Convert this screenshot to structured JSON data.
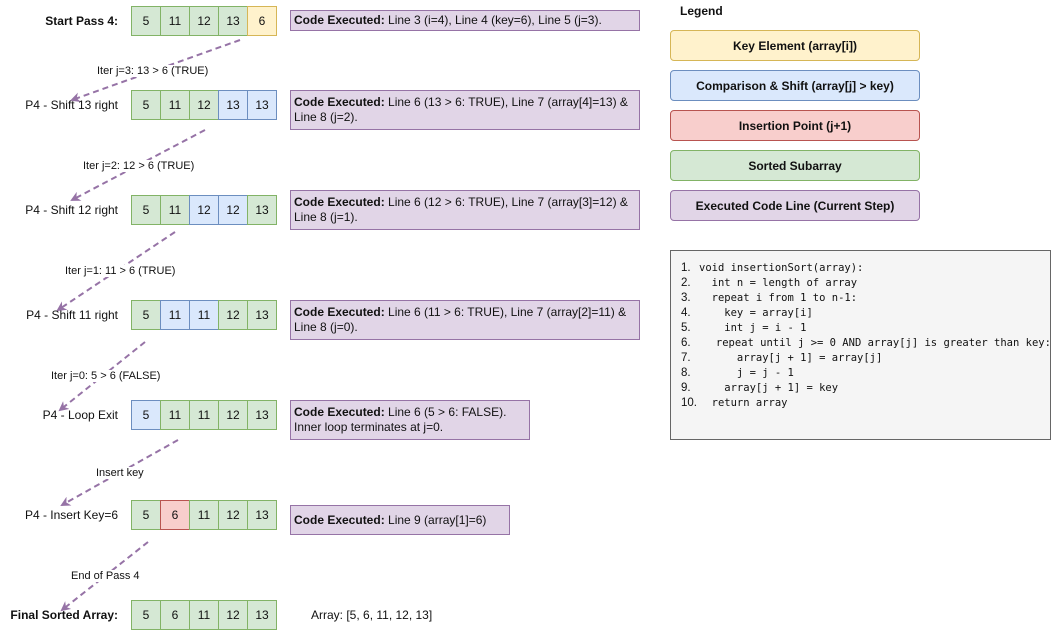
{
  "colors": {
    "sorted": "#d5e8d4",
    "key": "#fff2cc",
    "shift": "#dae8fc",
    "insert": "#f8cecc",
    "code": "#e1d5e7",
    "arrow": "#9673a6"
  },
  "rows": [
    {
      "label": "Start Pass 4:",
      "bold": true,
      "cells": [
        {
          "v": "5",
          "t": "sorted"
        },
        {
          "v": "11",
          "t": "sorted"
        },
        {
          "v": "12",
          "t": "sorted"
        },
        {
          "v": "13",
          "t": "sorted"
        },
        {
          "v": "6",
          "t": "key"
        }
      ],
      "code_prefix": "Code Executed:",
      "code_text": "Line 3 (i=4), Line 4 (key=6), Line 5 (j=3)."
    },
    {
      "label": "P4 - Shift 13 right",
      "bold": false,
      "cells": [
        {
          "v": "5",
          "t": "sorted"
        },
        {
          "v": "11",
          "t": "sorted"
        },
        {
          "v": "12",
          "t": "sorted"
        },
        {
          "v": "13",
          "t": "shift"
        },
        {
          "v": "13",
          "t": "shift"
        }
      ],
      "code_prefix": "Code Executed:",
      "code_text": "Line 6 (13 > 6: TRUE), Line 7 (array[4]=13) & Line 8 (j=2)."
    },
    {
      "label": "P4 - Shift 12 right",
      "bold": false,
      "cells": [
        {
          "v": "5",
          "t": "sorted"
        },
        {
          "v": "11",
          "t": "sorted"
        },
        {
          "v": "12",
          "t": "shift"
        },
        {
          "v": "12",
          "t": "shift"
        },
        {
          "v": "13",
          "t": "sorted"
        }
      ],
      "code_prefix": "Code Executed:",
      "code_text": "Line 6 (12 > 6: TRUE), Line 7 (array[3]=12) & Line 8 (j=1)."
    },
    {
      "label": "P4 - Shift 11 right",
      "bold": false,
      "cells": [
        {
          "v": "5",
          "t": "sorted"
        },
        {
          "v": "11",
          "t": "shift"
        },
        {
          "v": "11",
          "t": "shift"
        },
        {
          "v": "12",
          "t": "sorted"
        },
        {
          "v": "13",
          "t": "sorted"
        }
      ],
      "code_prefix": "Code Executed:",
      "code_text": "Line 6 (11 > 6: TRUE), Line 7 (array[2]=11) & Line 8 (j=0)."
    },
    {
      "label": "P4 - Loop Exit",
      "bold": false,
      "cells": [
        {
          "v": "5",
          "t": "shift"
        },
        {
          "v": "11",
          "t": "sorted"
        },
        {
          "v": "11",
          "t": "sorted"
        },
        {
          "v": "12",
          "t": "sorted"
        },
        {
          "v": "13",
          "t": "sorted"
        }
      ],
      "code_prefix": "Code Executed:",
      "code_text": "Line 6 (5 > 6: FALSE). Inner loop terminates at j=0."
    },
    {
      "label": "P4 - Insert Key=6",
      "bold": false,
      "cells": [
        {
          "v": "5",
          "t": "sorted"
        },
        {
          "v": "6",
          "t": "insert"
        },
        {
          "v": "11",
          "t": "sorted"
        },
        {
          "v": "12",
          "t": "sorted"
        },
        {
          "v": "13",
          "t": "sorted"
        }
      ],
      "code_prefix": "Code Executed:",
      "code_text": "Line 9 (array[1]=6)"
    },
    {
      "label": "Final Sorted Array:",
      "bold": true,
      "cells": [
        {
          "v": "5",
          "t": "sorted"
        },
        {
          "v": "6",
          "t": "sorted"
        },
        {
          "v": "11",
          "t": "sorted"
        },
        {
          "v": "12",
          "t": "sorted"
        },
        {
          "v": "13",
          "t": "sorted"
        }
      ],
      "final_text": "Array: [5, 6, 11, 12, 13]"
    }
  ],
  "arrow_labels": [
    "Iter j=3: 13 > 6 (TRUE)",
    "Iter j=2: 12 > 6 (TRUE)",
    "Iter j=1: 11 > 6 (TRUE)",
    "Iter j=0: 5 > 6 (FALSE)",
    "Insert key",
    "End of Pass 4"
  ],
  "legend": {
    "title": "Legend",
    "items": [
      {
        "label": "Key Element (array[i])",
        "color": "#fff2cc",
        "border": "#d6b656"
      },
      {
        "label": "Comparison & Shift (array[j] > key)",
        "color": "#dae8fc",
        "border": "#6c8ebf"
      },
      {
        "label": "Insertion Point (j+1)",
        "color": "#f8cecc",
        "border": "#b85450"
      },
      {
        "label": "Sorted Subarray",
        "color": "#d5e8d4",
        "border": "#82b366"
      },
      {
        "label": "Executed Code Line (Current Step)",
        "color": "#e1d5e7",
        "border": "#9673a6"
      }
    ]
  },
  "pseudocode": [
    {
      "n": "1.",
      "t": "void insertionSort(array):"
    },
    {
      "n": "2.",
      "t": "  int n = length of array"
    },
    {
      "n": "3.",
      "t": "  repeat i from 1 to n-1:"
    },
    {
      "n": "4.",
      "t": "    key = array[i]"
    },
    {
      "n": "5.",
      "t": "    int j = i - 1"
    },
    {
      "n": "6.",
      "t": "    repeat until j >= 0 AND array[j] is greater than key:"
    },
    {
      "n": "7.",
      "t": "      array[j + 1] = array[j]"
    },
    {
      "n": "8.",
      "t": "      j = j - 1"
    },
    {
      "n": "9.",
      "t": "    array[j + 1] = key"
    },
    {
      "n": "10.",
      "t": "  return array"
    }
  ]
}
